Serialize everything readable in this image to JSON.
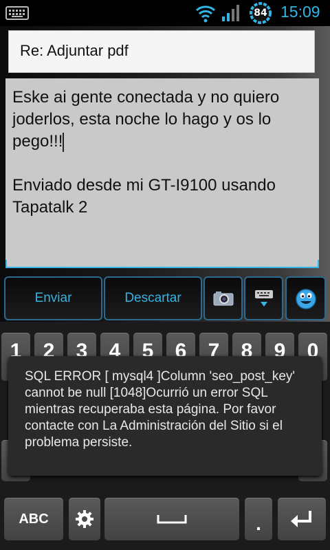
{
  "status_bar": {
    "battery_level": "84",
    "time": "15:09",
    "accent_color": "#33b5e5",
    "icons": [
      "keyboard-icon",
      "wifi-icon",
      "signal-icon",
      "battery-icon"
    ]
  },
  "compose": {
    "subject": "Re: Adjuntar pdf",
    "body_lines": [
      "Eske ai gente conectada y no quiero",
      "joderlos, esta noche lo hago y os lo",
      "pego!!!",
      "",
      "Enviado desde mi GT-I9100 usando",
      "Tapatalk 2"
    ]
  },
  "actions": {
    "send_label": "Enviar",
    "discard_label": "Descartar",
    "camera_icon": "camera-icon",
    "hide_keyboard_icon": "hide-keyboard-icon",
    "emoji_icon": "emoji-icon"
  },
  "keyboard": {
    "number_keys": [
      "1",
      "2",
      "3",
      "4",
      "5",
      "6",
      "7",
      "8",
      "9",
      "0"
    ],
    "abc_label": "ABC",
    "dot_label": ".",
    "settings_icon": "gear-icon",
    "space_icon": "space-icon",
    "enter_icon": "enter-icon"
  },
  "toast": {
    "message": "SQL ERROR [ mysql4 ]Column 'seo_post_key' cannot be null [1048]Ocurrió un error SQL mientras recuperaba esta página. Por favor contacte con La Administración del Sitio si el problema persiste."
  }
}
